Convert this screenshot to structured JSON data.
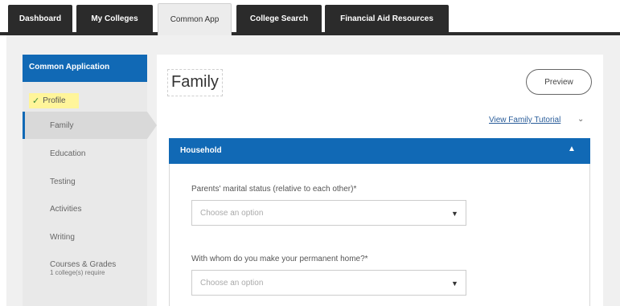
{
  "tabs": [
    {
      "label": "Dashboard"
    },
    {
      "label": "My Colleges"
    },
    {
      "label": "Common App"
    },
    {
      "label": "College Search"
    },
    {
      "label": "Financial Aid Resources"
    }
  ],
  "sidebar": {
    "header": "Common Application",
    "items": [
      {
        "label": "Profile"
      },
      {
        "label": "Family"
      },
      {
        "label": "Education"
      },
      {
        "label": "Testing"
      },
      {
        "label": "Activities"
      },
      {
        "label": "Writing"
      },
      {
        "label": "Courses & Grades",
        "sub": "1 college(s) require"
      }
    ]
  },
  "main": {
    "title": "Family",
    "preview_label": "Preview",
    "tutorial_link": "View Family Tutorial",
    "section_title": "Household",
    "questions": [
      {
        "label": "Parents' marital status (relative to each other)*",
        "placeholder": "Choose an option"
      },
      {
        "label": "With whom do you make your permanent home?*",
        "placeholder": "Choose an option"
      }
    ]
  },
  "colors": {
    "accent": "#1169b5",
    "tab_dark": "#2b2b2b",
    "highlight": "#fff59a"
  }
}
